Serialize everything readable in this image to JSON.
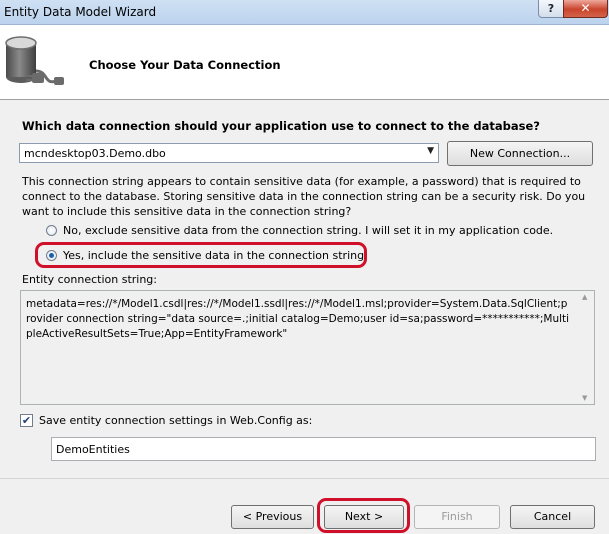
{
  "window": {
    "title": "Entity Data Model Wizard",
    "help_label": "?",
    "close_label": "✕"
  },
  "header": {
    "title": "Choose Your Data Connection",
    "icon": "database-plug-icon"
  },
  "main": {
    "question": "Which data connection should your application use to connect to the database?",
    "connection_select": {
      "value": "mcndesktop03.Demo.dbo",
      "arrow": "▼"
    },
    "new_connection_label": "New Connection...",
    "warning_text": "This connection string appears to contain sensitive data (for example, a password) that is required to connect to the database. Storing sensitive data in the connection string can be a security risk. Do you want to include this sensitive data in the connection string?",
    "radio_no_label": "No, exclude sensitive data from the connection string. I will set it in my application code.",
    "radio_yes_label": "Yes, include the sensitive data in the connection string.",
    "selected_radio": "yes",
    "ecs_label": "Entity connection string:",
    "ecs_value": "metadata=res://*/Model1.csdl|res://*/Model1.ssdl|res://*/Model1.msl;provider=System.Data.SqlClient;provider connection string=\"data source=.;initial catalog=Demo;user id=sa;password=***********;MultipleActiveResultSets=True;App=EntityFramework\"",
    "save_checked": true,
    "save_check_mark": "✔",
    "save_label": "Save entity connection settings in Web.Config as:",
    "entity_name": "DemoEntities"
  },
  "footer": {
    "previous_label": "< Previous",
    "next_label": "Next >",
    "finish_label": "Finish",
    "cancel_label": "Cancel"
  },
  "colors": {
    "highlight": "#d0102a",
    "titlebar": "#bcd3ee",
    "close_button": "#c9442d"
  }
}
